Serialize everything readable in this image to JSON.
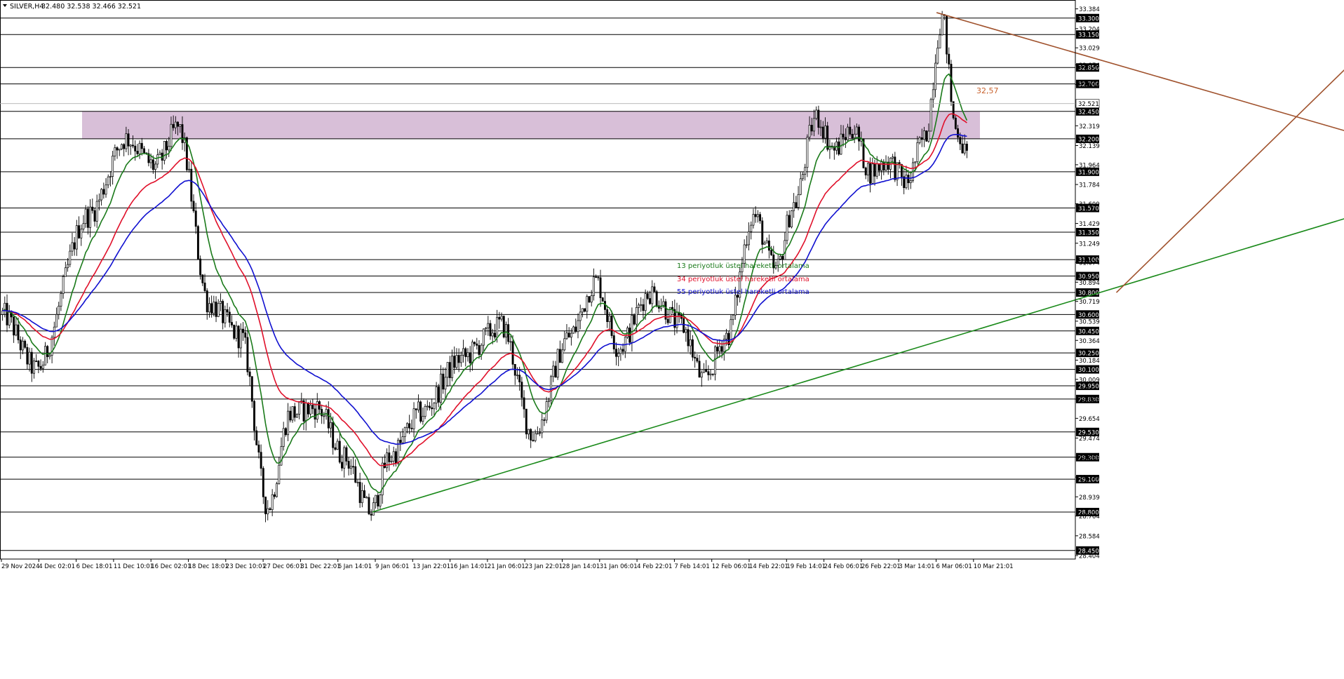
{
  "header": {
    "symbol": "SILVER,H4",
    "ohlc": "32.480 32.538 32.466 32.521"
  },
  "annotations": {
    "ema13_label": "13 periyotluk üstel hareketli ortalama",
    "ema34_label": "34 periyotluk üstel hareketli ortalama",
    "ema55_label": "55 periyotluk üstel hareketli ortalama",
    "price_callout": "32,57"
  },
  "colors": {
    "candle": "#000000",
    "ema13": "#1a7a1a",
    "ema34": "#e0102a",
    "ema55": "#1010d0",
    "support_trend": "#1a8a1a",
    "wedge_lines": "#a0522d",
    "resistance_zone": "#d8bfd8",
    "level_line": "#000000",
    "callout": "#c8622e",
    "price_tag_bg": "#000000",
    "price_tag_fg": "#ffffff"
  },
  "chart_data": {
    "type": "candlestick",
    "title": "SILVER,H4",
    "ylim": [
      28.404,
      33.388
    ],
    "y_ticks": [
      "33.384",
      "33.204",
      "33.029",
      "32.874",
      "32.694",
      "32.499",
      "32.319",
      "32.139",
      "31.964",
      "31.784",
      "31.609",
      "31.429",
      "31.249",
      "31.074",
      "30.894",
      "30.719",
      "30.539",
      "30.364",
      "30.184",
      "30.009",
      "29.829",
      "29.654",
      "29.474",
      "29.299",
      "29.119",
      "28.939",
      "28.764",
      "28.584",
      "28.404"
    ],
    "x_ticks": [
      "29 Nov 2024",
      "4 Dec 02:01",
      "6 Dec 18:01",
      "11 Dec 10:01",
      "16 Dec 02:01",
      "18 Dec 18:01",
      "23 Dec 10:01",
      "27 Dec 06:01",
      "31 Dec 22:01",
      "6 Jan 14:01",
      "9 Jan 06:01",
      "13 Jan 22:01",
      "16 Jan 14:01",
      "21 Jan 06:01",
      "23 Jan 22:01",
      "28 Jan 14:01",
      "31 Jan 06:01",
      "4 Feb 22:01",
      "7 Feb 14:01",
      "12 Feb 06:01",
      "14 Feb 22:01",
      "19 Feb 14:01",
      "24 Feb 06:01",
      "26 Feb 22:01",
      "3 Mar 14:01",
      "6 Mar 06:01",
      "10 Mar 21:01"
    ],
    "x_start": "29 Nov 2024",
    "bar_count": 430,
    "current_price": "32.521",
    "horizontal_levels": [
      "33.300",
      "33.150",
      "32.850",
      "32.700",
      "32.450",
      "32.200",
      "31.900",
      "31.570",
      "31.350",
      "31.100",
      "30.950",
      "30.800",
      "30.600",
      "30.450",
      "30.250",
      "30.100",
      "29.950",
      "29.830",
      "29.530",
      "29.300",
      "29.100",
      "28.800",
      "28.450"
    ],
    "resistance_zone": [
      32.2,
      32.45
    ],
    "series": [
      {
        "name": "13 periyotluk üstel hareketli ortalama",
        "period": 13
      },
      {
        "name": "34 periyotluk üstel hareketli ortalama",
        "period": 34
      },
      {
        "name": "55 periyotluk üstel hareketli ortalama",
        "period": 55
      }
    ],
    "key_points": [
      {
        "x": 0,
        "y": 30.6
      },
      {
        "x": 15,
        "y": 30.1
      },
      {
        "x": 38,
        "y": 31.5
      },
      {
        "x": 55,
        "y": 32.2
      },
      {
        "x": 68,
        "y": 31.95
      },
      {
        "x": 78,
        "y": 32.3
      },
      {
        "x": 92,
        "y": 30.7
      },
      {
        "x": 106,
        "y": 30.4
      },
      {
        "x": 118,
        "y": 28.85
      },
      {
        "x": 128,
        "y": 29.7
      },
      {
        "x": 140,
        "y": 29.75
      },
      {
        "x": 152,
        "y": 29.3
      },
      {
        "x": 164,
        "y": 28.8
      },
      {
        "x": 172,
        "y": 29.3
      },
      {
        "x": 186,
        "y": 29.7
      },
      {
        "x": 204,
        "y": 30.2
      },
      {
        "x": 222,
        "y": 30.5
      },
      {
        "x": 236,
        "y": 29.5
      },
      {
        "x": 252,
        "y": 30.4
      },
      {
        "x": 264,
        "y": 30.9
      },
      {
        "x": 274,
        "y": 30.3
      },
      {
        "x": 288,
        "y": 30.8
      },
      {
        "x": 302,
        "y": 30.5
      },
      {
        "x": 312,
        "y": 30.0
      },
      {
        "x": 322,
        "y": 30.4
      },
      {
        "x": 334,
        "y": 31.5
      },
      {
        "x": 344,
        "y": 31.0
      },
      {
        "x": 352,
        "y": 31.6
      },
      {
        "x": 362,
        "y": 32.4
      },
      {
        "x": 370,
        "y": 32.1
      },
      {
        "x": 378,
        "y": 32.3
      },
      {
        "x": 386,
        "y": 31.9
      },
      {
        "x": 394,
        "y": 32.0
      },
      {
        "x": 402,
        "y": 31.8
      },
      {
        "x": 410,
        "y": 32.2
      },
      {
        "x": 418,
        "y": 33.3
      },
      {
        "x": 424,
        "y": 32.3
      },
      {
        "x": 430,
        "y": 32.0
      }
    ],
    "trendlines": [
      {
        "name": "support",
        "from": {
          "bar": 165,
          "y": 28.8
        },
        "to": {
          "bar": 610,
          "y": 31.55
        }
      },
      {
        "name": "wedge-upper",
        "from": {
          "bar": 416,
          "y": 33.35
        },
        "to": {
          "bar": 610,
          "y": 32.2
        }
      },
      {
        "name": "wedge-lower",
        "from": {
          "bar": 496,
          "y": 30.8
        },
        "to": {
          "bar": 610,
          "y": 33.08
        }
      }
    ]
  }
}
